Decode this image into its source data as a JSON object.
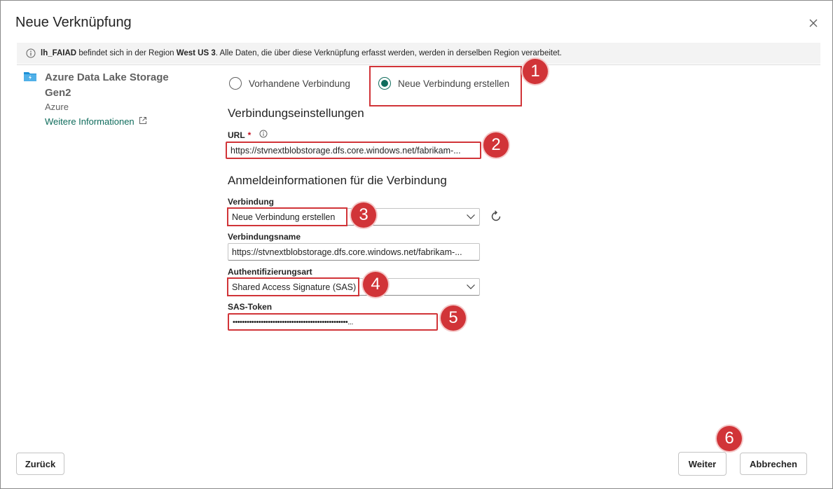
{
  "dialog": {
    "title": "Neue Verknüpfung"
  },
  "infobar": {
    "lakehouse": "lh_FAIAD",
    "text_a": " befindet sich in der Region ",
    "region": "West US 3",
    "text_b": ". Alle Daten, die über diese Verknüpfung erfasst werden, werden in derselben Region verarbeitet."
  },
  "source": {
    "name": "Azure Data Lake Storage Gen2",
    "category": "Azure",
    "link": "Weitere Informationen"
  },
  "connection_mode": {
    "existing_label": "Vorhandene Verbindung",
    "new_label": "Neue Verbindung erstellen",
    "selected": "new"
  },
  "settings": {
    "heading": "Verbindungseinstellungen",
    "url_label": "URL",
    "url_required": "*",
    "url_value": "https://stvnextblobstorage.dfs.core.windows.net/fabrikam-..."
  },
  "credentials": {
    "heading": "Anmeldeinformationen für die Verbindung",
    "connection_label": "Verbindung",
    "connection_value": "Neue Verbindung erstellen",
    "name_label": "Verbindungsname",
    "name_value": "https://stvnextblobstorage.dfs.core.windows.net/fabrikam-...",
    "auth_label": "Authentifizierungsart",
    "auth_value": "Shared Access Signature (SAS)",
    "token_label": "SAS-Token",
    "token_value": "•••••••••••••••••••••••••••••••••••••••••••••••••..."
  },
  "callouts": [
    "1",
    "2",
    "3",
    "4",
    "5",
    "6"
  ],
  "footer": {
    "back": "Zurück",
    "next": "Weiter",
    "cancel": "Abbrechen"
  },
  "colors": {
    "accent": "#0f6c5c",
    "highlight": "#d13438"
  }
}
